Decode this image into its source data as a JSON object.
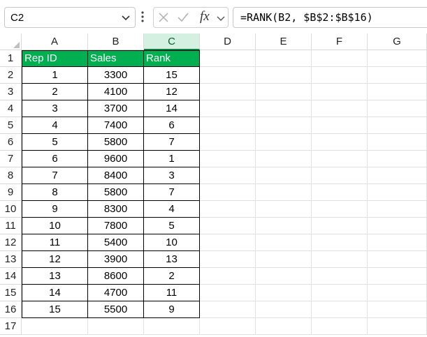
{
  "formula_bar": {
    "name_box": "C2",
    "fx_label": "fx",
    "formula": "=RANK(B2, $B$2:$B$16)"
  },
  "columns": [
    "A",
    "B",
    "C",
    "D",
    "E",
    "F",
    "G"
  ],
  "selected_column": "C",
  "rows": [
    "1",
    "2",
    "3",
    "4",
    "5",
    "6",
    "7",
    "8",
    "9",
    "10",
    "11",
    "12",
    "13",
    "14",
    "15",
    "16",
    "17"
  ],
  "table": {
    "headers": [
      "Rep ID",
      "Sales",
      "Rank"
    ],
    "rows": [
      [
        "1",
        "3300",
        "15"
      ],
      [
        "2",
        "4100",
        "12"
      ],
      [
        "3",
        "3700",
        "14"
      ],
      [
        "4",
        "7400",
        "6"
      ],
      [
        "5",
        "5800",
        "7"
      ],
      [
        "6",
        "9600",
        "1"
      ],
      [
        "7",
        "8400",
        "3"
      ],
      [
        "8",
        "5800",
        "7"
      ],
      [
        "9",
        "8300",
        "4"
      ],
      [
        "10",
        "7800",
        "5"
      ],
      [
        "11",
        "5400",
        "10"
      ],
      [
        "12",
        "3900",
        "13"
      ],
      [
        "13",
        "8600",
        "2"
      ],
      [
        "14",
        "4700",
        "11"
      ],
      [
        "15",
        "5500",
        "9"
      ]
    ]
  },
  "colors": {
    "header_fill": "#00b050",
    "selection_accent": "#107c41"
  }
}
